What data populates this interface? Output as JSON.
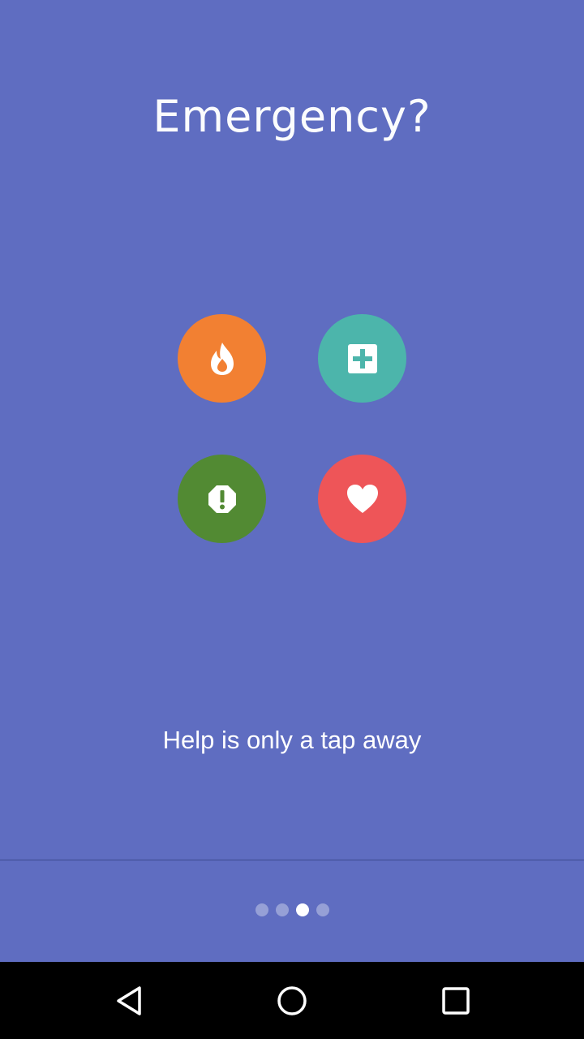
{
  "onboarding": {
    "title": "Emergency?",
    "tagline": "Help is only a tap away",
    "buttons": [
      {
        "name": "fire",
        "icon": "fire-icon",
        "color": "#f28032"
      },
      {
        "name": "medical",
        "icon": "medical-cross-icon",
        "color": "#4cb5ab"
      },
      {
        "name": "alert",
        "icon": "alert-octagon-icon",
        "color": "#528a33"
      },
      {
        "name": "heart",
        "icon": "heart-icon",
        "color": "#ee5558"
      }
    ],
    "pager": {
      "total": 4,
      "current": 3
    }
  },
  "navbar": {
    "back_icon": "back-triangle-icon",
    "home_icon": "home-circle-icon",
    "recent_icon": "recent-square-icon"
  },
  "colors": {
    "background": "#5f6dc1",
    "navbar": "#000000"
  }
}
